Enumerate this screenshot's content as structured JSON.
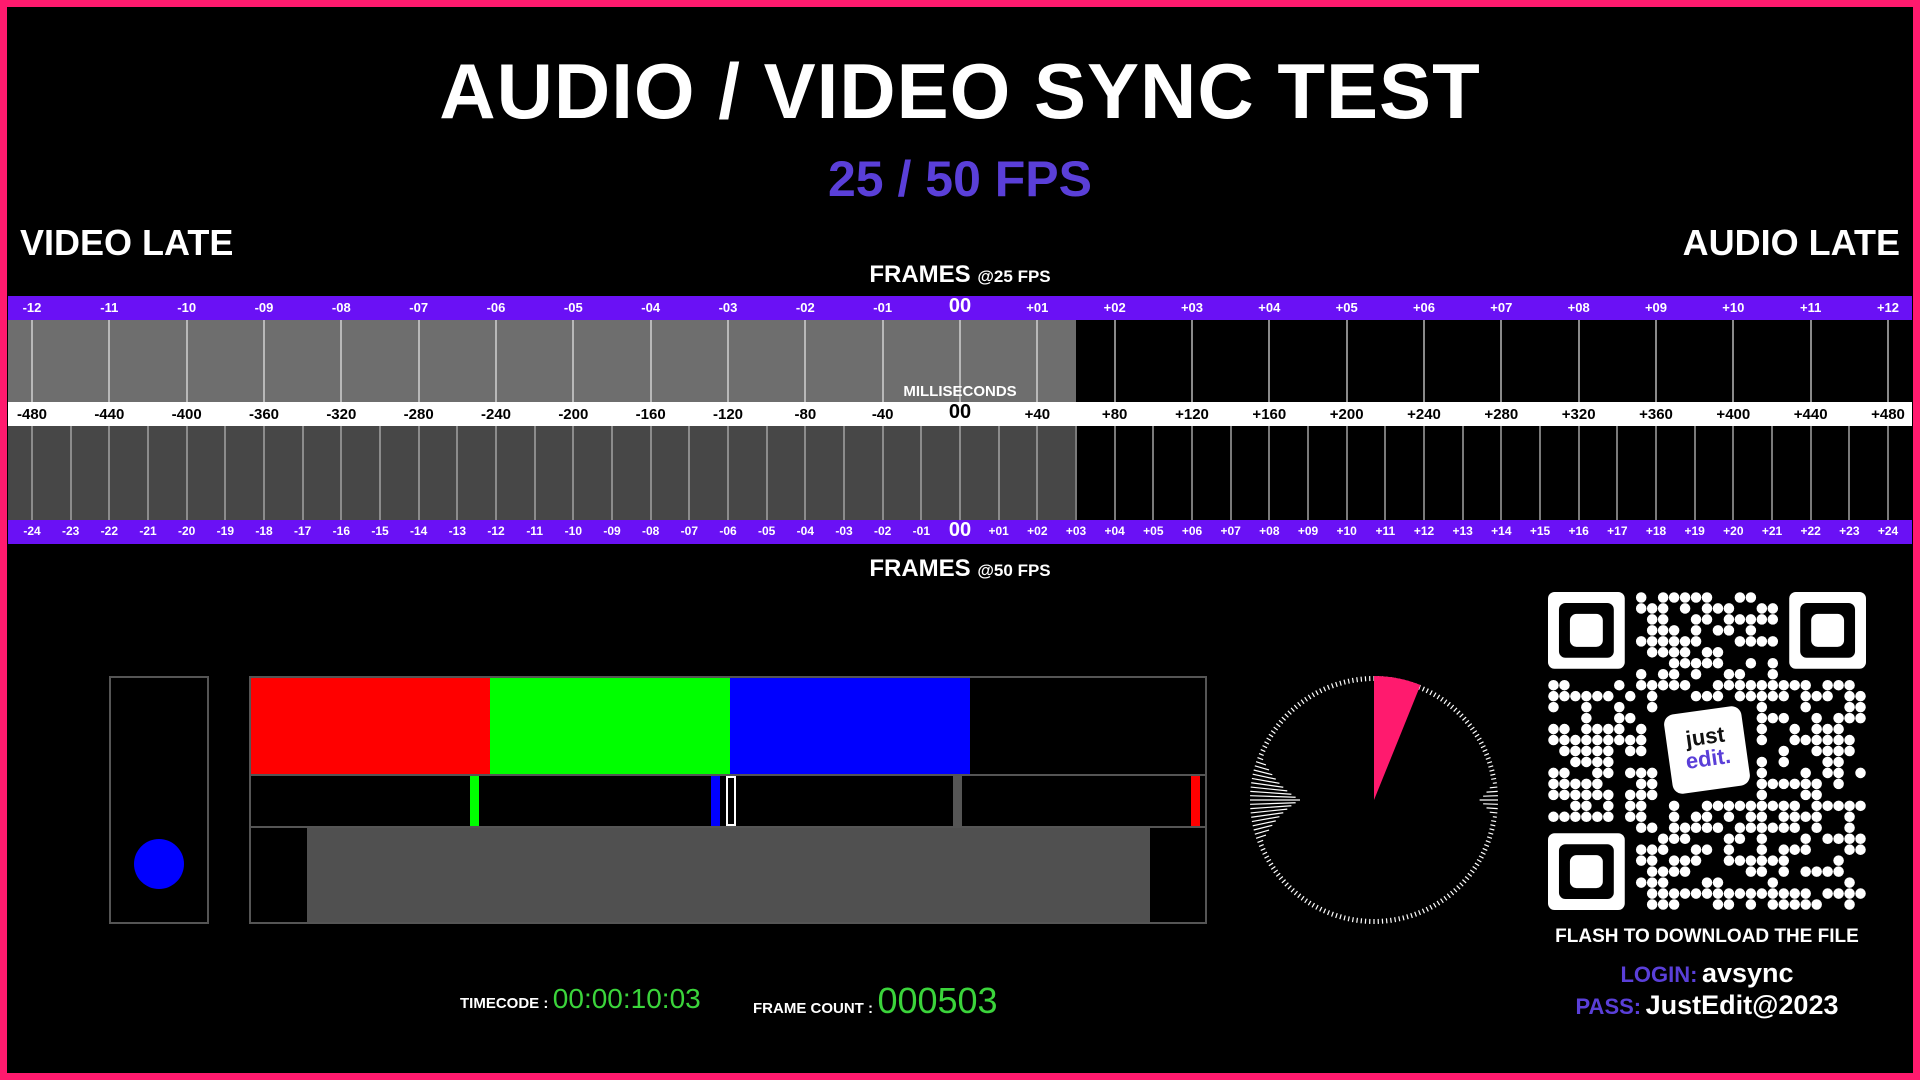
{
  "title": "AUDIO / VIDEO SYNC TEST",
  "subtitle": "25 / 50 FPS",
  "labels": {
    "video_late": "VIDEO LATE",
    "audio_late": "AUDIO LATE"
  },
  "frames25_caption": {
    "main": "FRAMES",
    "suffix": "@25 FPS"
  },
  "frames50_caption": {
    "main": "FRAMES",
    "suffix": "@50 FPS"
  },
  "milliseconds_caption": "MILLISECONDS",
  "ticks25": [
    "-12",
    "-11",
    "-10",
    "-09",
    "-08",
    "-07",
    "-06",
    "-05",
    "-04",
    "-03",
    "-02",
    "-01",
    "00",
    "+01",
    "+02",
    "+03",
    "+04",
    "+05",
    "+06",
    "+07",
    "+08",
    "+09",
    "+10",
    "+11",
    "+12"
  ],
  "ticks_ms": [
    "-480",
    "-440",
    "-400",
    "-360",
    "-320",
    "-280",
    "-240",
    "-200",
    "-160",
    "-120",
    "-80",
    "-40",
    "00",
    "+40",
    "+80",
    "+120",
    "+160",
    "+200",
    "+240",
    "+280",
    "+320",
    "+360",
    "+400",
    "+440",
    "+480"
  ],
  "ticks50": [
    "-24",
    "-23",
    "-22",
    "-21",
    "-20",
    "-19",
    "-18",
    "-17",
    "-16",
    "-15",
    "-14",
    "-13",
    "-12",
    "-11",
    "-10",
    "-09",
    "-08",
    "-07",
    "-06",
    "-05",
    "-04",
    "-03",
    "-02",
    "-01",
    "00",
    "+01",
    "+02",
    "+03",
    "+04",
    "+05",
    "+06",
    "+07",
    "+08",
    "+09",
    "+10",
    "+11",
    "+12",
    "+13",
    "+14",
    "+15",
    "+16",
    "+17",
    "+18",
    "+19",
    "+20",
    "+21",
    "+22",
    "+23",
    "+24"
  ],
  "scale_fill_until_frame25": 1.5,
  "colors": {
    "accent_purple": "#5a3fd8",
    "strip_purple": "#6a11f5",
    "border_pink": "#ff1a6e",
    "red": "#ff0000",
    "green": "#00ff00",
    "blue": "#0000ff",
    "dial_wedge": "#ff1a6e",
    "timecode_green": "#3bd43b"
  },
  "qr": {
    "caption": "FLASH TO DOWNLOAD THE FILE",
    "logo_top": "just",
    "logo_bottom": "edit."
  },
  "credentials": {
    "login_label": "LOGIN:",
    "login_value": "avsync",
    "pass_label": "PASS:",
    "pass_value": "JustEdit@2023"
  },
  "timecode": {
    "label": "TIMECODE :",
    "value": "00:00:10:03"
  },
  "frame_count": {
    "label": "FRAME COUNT :",
    "value": "000503"
  }
}
